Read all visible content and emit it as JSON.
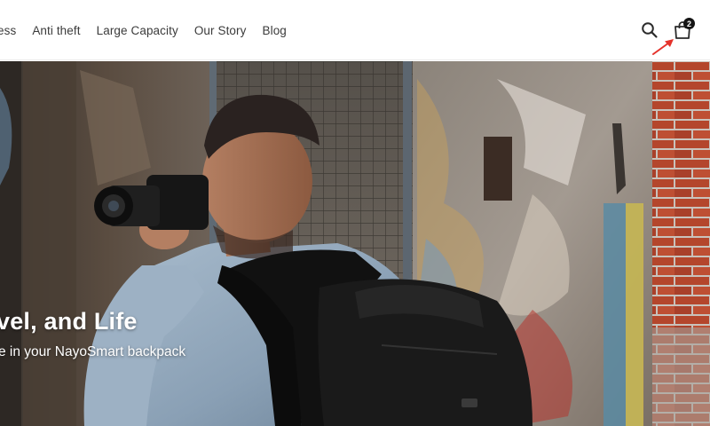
{
  "nav": {
    "items": [
      {
        "label": "ess"
      },
      {
        "label": "Anti theft"
      },
      {
        "label": "Large Capacity"
      },
      {
        "label": "Our Story"
      },
      {
        "label": "Blog"
      }
    ]
  },
  "header": {
    "search_icon": "search-icon",
    "cart_icon": "shopping-bag-icon",
    "cart_count": "2"
  },
  "hero": {
    "title": "vel, and Life",
    "subtitle": "e in your NayoSmart backpack",
    "image": "photographer-with-camera-and-black-backpack-in-front-of-graffiti-wall"
  },
  "colors": {
    "text": "#3b3b3b",
    "badge": "#141414",
    "annotation_arrow": "#e5322b",
    "hero_text": "#ffffff"
  }
}
